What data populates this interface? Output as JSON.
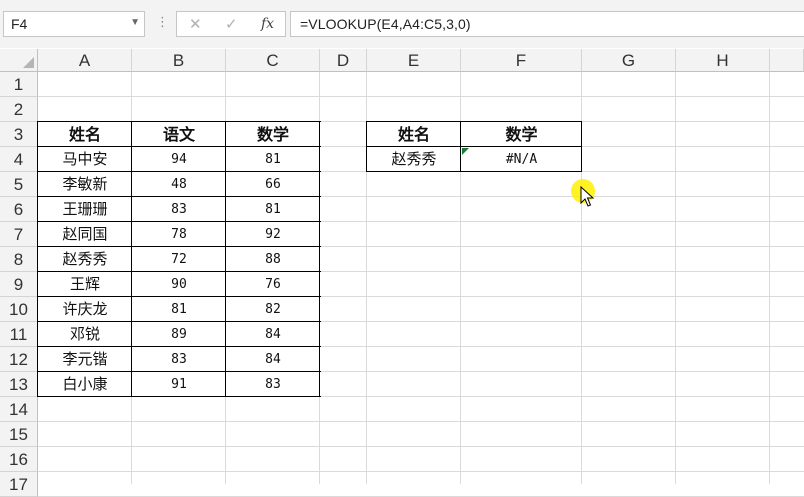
{
  "formula_bar": {
    "name_box": "F4",
    "formula": "=VLOOKUP(E4,A4:C5,3,0)",
    "cancel_icon": "✕",
    "enter_icon": "✓",
    "fx_icon": "fx"
  },
  "columns": [
    "A",
    "B",
    "C",
    "D",
    "E",
    "F",
    "G",
    "H"
  ],
  "rows": [
    "1",
    "2",
    "3",
    "4",
    "5",
    "6",
    "7",
    "8",
    "9",
    "10",
    "11",
    "12",
    "13",
    "14",
    "15",
    "16",
    "17"
  ],
  "table1": {
    "headers": [
      "姓名",
      "语文",
      "数学"
    ],
    "rows": [
      [
        "马中安",
        "94",
        "81"
      ],
      [
        "李敏新",
        "48",
        "66"
      ],
      [
        "王珊珊",
        "83",
        "81"
      ],
      [
        "赵同国",
        "78",
        "92"
      ],
      [
        "赵秀秀",
        "72",
        "88"
      ],
      [
        "王辉",
        "90",
        "76"
      ],
      [
        "许庆龙",
        "81",
        "82"
      ],
      [
        "邓锐",
        "89",
        "84"
      ],
      [
        "李元锴",
        "83",
        "84"
      ],
      [
        "白小康",
        "91",
        "83"
      ]
    ]
  },
  "table2": {
    "headers": [
      "姓名",
      "数学"
    ],
    "row": [
      "赵秀秀",
      "#N/A"
    ]
  },
  "colors": {
    "grid": "#dadada",
    "header_bg": "#f3f3f3",
    "error_indicator": "#1b7a36",
    "cursor_highlight": "#fff000"
  }
}
